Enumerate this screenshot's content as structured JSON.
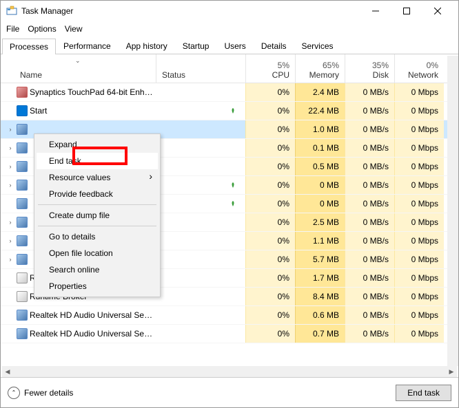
{
  "title": "Task Manager",
  "menu": {
    "file": "File",
    "options": "Options",
    "view": "View"
  },
  "tabs": [
    "Processes",
    "Performance",
    "App history",
    "Startup",
    "Users",
    "Details",
    "Services"
  ],
  "columns": {
    "name": "Name",
    "status": "Status",
    "cpu": {
      "pct": "5%",
      "label": "CPU"
    },
    "memory": {
      "pct": "65%",
      "label": "Memory"
    },
    "disk": {
      "pct": "35%",
      "label": "Disk"
    },
    "network": {
      "pct": "0%",
      "label": "Network"
    }
  },
  "rows": [
    {
      "name": "Synaptics TouchPad 64-bit Enha...",
      "exp": false,
      "cpu": "0%",
      "mem": "2.4 MB",
      "disk": "0 MB/s",
      "net": "0 Mbps",
      "icon": "red"
    },
    {
      "name": "Start",
      "exp": false,
      "cpu": "0%",
      "mem": "22.4 MB",
      "disk": "0 MB/s",
      "net": "0 Mbps",
      "icon": "start",
      "leaf": true
    },
    {
      "name": "",
      "exp": true,
      "cpu": "0%",
      "mem": "1.0 MB",
      "disk": "0 MB/s",
      "net": "0 Mbps",
      "sel": true
    },
    {
      "name": "",
      "exp": true,
      "cpu": "0%",
      "mem": "0.1 MB",
      "disk": "0 MB/s",
      "net": "0 Mbps"
    },
    {
      "name": "",
      "exp": true,
      "cpu": "0%",
      "mem": "0.5 MB",
      "disk": "0 MB/s",
      "net": "0 Mbps"
    },
    {
      "name": "",
      "exp": true,
      "cpu": "0%",
      "mem": "0 MB",
      "disk": "0 MB/s",
      "net": "0 Mbps",
      "leaf": true
    },
    {
      "name": "",
      "exp": false,
      "cpu": "0%",
      "mem": "0 MB",
      "disk": "0 MB/s",
      "net": "0 Mbps",
      "leaf": true
    },
    {
      "name": "",
      "exp": true,
      "cpu": "0%",
      "mem": "2.5 MB",
      "disk": "0 MB/s",
      "net": "0 Mbps"
    },
    {
      "name": "",
      "exp": true,
      "cpu": "0%",
      "mem": "1.1 MB",
      "disk": "0 MB/s",
      "net": "0 Mbps"
    },
    {
      "name": "",
      "exp": true,
      "cpu": "0%",
      "mem": "5.7 MB",
      "disk": "0 MB/s",
      "net": "0 Mbps"
    },
    {
      "name": "Runtime Broker",
      "exp": false,
      "cpu": "0%",
      "mem": "1.7 MB",
      "disk": "0 MB/s",
      "net": "0 Mbps",
      "icon": "rt"
    },
    {
      "name": "Runtime Broker",
      "exp": false,
      "cpu": "0%",
      "mem": "8.4 MB",
      "disk": "0 MB/s",
      "net": "0 Mbps",
      "icon": "rt"
    },
    {
      "name": "Realtek HD Audio Universal Serv...",
      "exp": false,
      "cpu": "0%",
      "mem": "0.6 MB",
      "disk": "0 MB/s",
      "net": "0 Mbps"
    },
    {
      "name": "Realtek HD Audio Universal Serv...",
      "exp": false,
      "cpu": "0%",
      "mem": "0.7 MB",
      "disk": "0 MB/s",
      "net": "0 Mbps"
    }
  ],
  "context": {
    "expand": "Expand",
    "endtask": "End task",
    "resource": "Resource values",
    "feedback": "Provide feedback",
    "dump": "Create dump file",
    "details": "Go to details",
    "location": "Open file location",
    "search": "Search online",
    "properties": "Properties"
  },
  "footer": {
    "fewer": "Fewer details",
    "endtask": "End task"
  }
}
